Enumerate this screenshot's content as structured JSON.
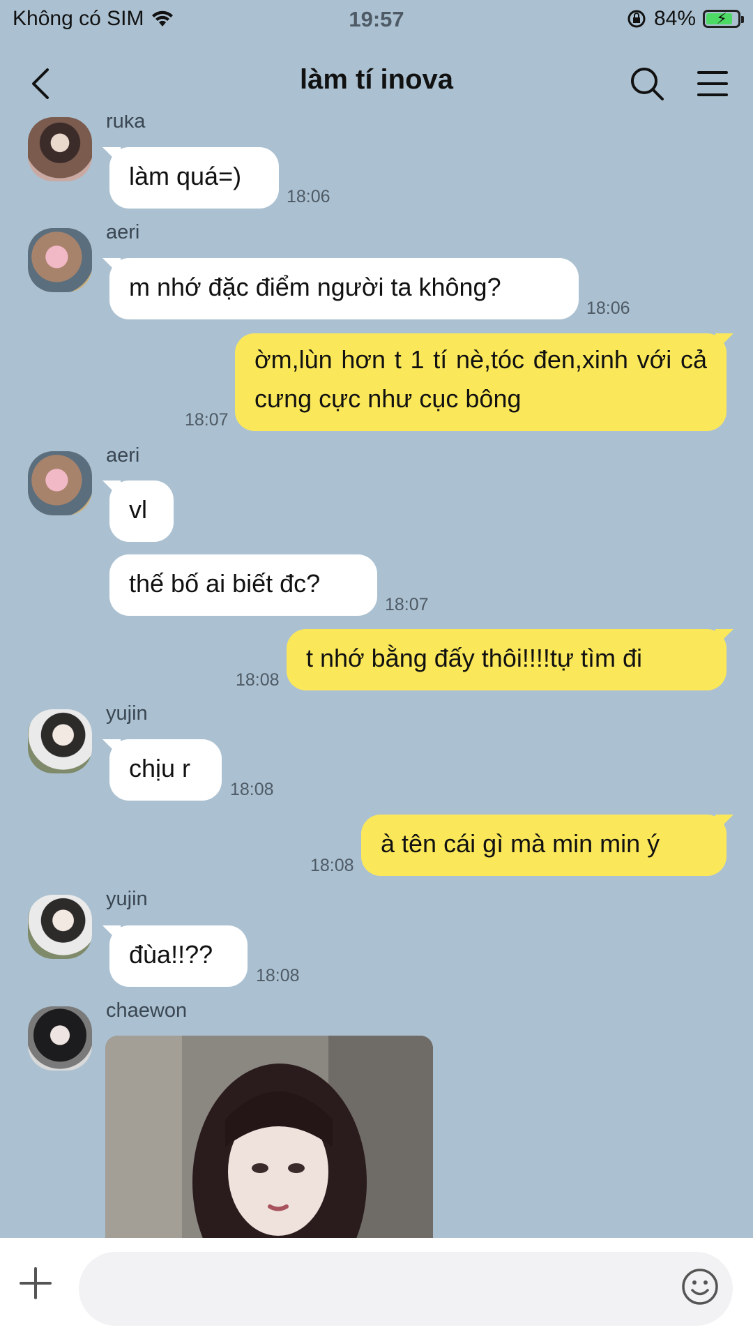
{
  "status_bar": {
    "carrier": "Không có SIM",
    "time": "19:57",
    "battery_percent": "84%",
    "battery_level": 0.84
  },
  "header": {
    "title": "làm tí inova"
  },
  "messages": [
    {
      "sender": "ruka",
      "text": "làm quá=)",
      "time": "18:06",
      "direction": "in"
    },
    {
      "sender": "aeri",
      "text": "m nhớ đặc điểm người ta không?",
      "time": "18:06",
      "direction": "in"
    },
    {
      "sender": "",
      "text": "ờm,lùn hơn t 1 tí nè,tóc đen,xinh với cả cưng cực như cục bông",
      "time": "18:07",
      "direction": "out"
    },
    {
      "sender": "aeri",
      "text": "vl",
      "time": "",
      "direction": "in"
    },
    {
      "sender": "",
      "text": "thế bố ai biết đc?",
      "time": "18:07",
      "direction": "in"
    },
    {
      "sender": "",
      "text": "t nhớ bằng đấy thôi!!!!tự tìm đi",
      "time": "18:08",
      "direction": "out"
    },
    {
      "sender": "yujin",
      "text": "chịu r",
      "time": "18:08",
      "direction": "in"
    },
    {
      "sender": "",
      "text": "à tên cái gì mà min min ý",
      "time": "18:08",
      "direction": "out"
    },
    {
      "sender": "yujin",
      "text": "đùa!!??",
      "time": "18:08",
      "direction": "in"
    },
    {
      "sender": "chaewon",
      "text": "",
      "time": "",
      "direction": "in",
      "attachment": "photo"
    }
  ],
  "colors": {
    "background": "#abc1d1",
    "incoming_bubble": "#ffffff",
    "outgoing_bubble": "#fbe85a",
    "battery_fill": "#4cd964"
  },
  "icons": [
    "back-arrow-icon",
    "search-icon",
    "menu-icon",
    "plus-icon",
    "emoji-icon",
    "wifi-icon",
    "orientation-lock-icon",
    "battery-icon"
  ]
}
